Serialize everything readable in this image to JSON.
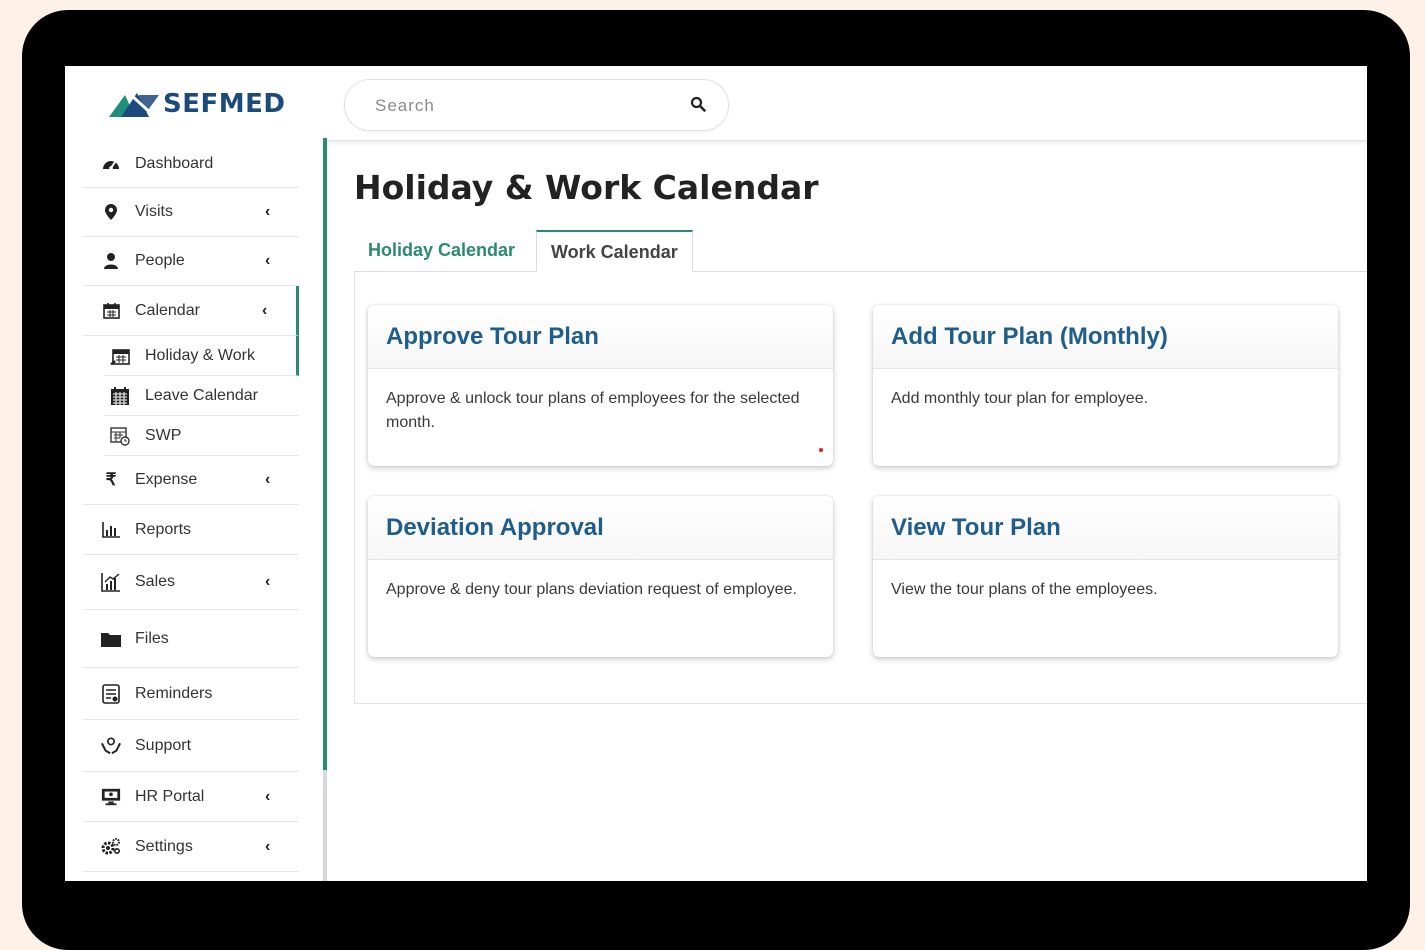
{
  "brand": {
    "logo_text": "SEFMED"
  },
  "search": {
    "placeholder": "Search"
  },
  "sidebar": {
    "items": [
      {
        "label": "Dashboard",
        "icon": "dashboard-icon",
        "has_chevron": false
      },
      {
        "label": "Visits",
        "icon": "map-pin-icon",
        "has_chevron": true
      },
      {
        "label": "People",
        "icon": "user-icon",
        "has_chevron": true
      },
      {
        "label": "Calendar",
        "icon": "calendar-icon",
        "has_chevron": true,
        "active": true
      },
      {
        "label": "Expense",
        "icon": "rupee-icon",
        "has_chevron": true
      },
      {
        "label": "Reports",
        "icon": "bar-chart-icon",
        "has_chevron": false
      },
      {
        "label": "Sales",
        "icon": "sales-chart-icon",
        "has_chevron": true
      },
      {
        "label": "Files",
        "icon": "folder-icon",
        "has_chevron": false
      },
      {
        "label": "Reminders",
        "icon": "reminder-list-icon",
        "has_chevron": false
      },
      {
        "label": "Support",
        "icon": "support-hands-icon",
        "has_chevron": false
      },
      {
        "label": "HR Portal",
        "icon": "monitor-icon",
        "has_chevron": true
      },
      {
        "label": "Settings",
        "icon": "gears-icon",
        "has_chevron": true
      }
    ],
    "calendar_sub": [
      {
        "label": "Holiday & Work",
        "icon": "calendar-edit-icon",
        "active": true
      },
      {
        "label": "Leave Calendar",
        "icon": "calendar-grid-icon"
      },
      {
        "label": "SWP",
        "icon": "calendar-clock-icon"
      }
    ],
    "chevron": "‹"
  },
  "page": {
    "title": "Holiday & Work Calendar",
    "tabs": [
      {
        "label": "Holiday Calendar"
      },
      {
        "label": "Work Calendar",
        "active": true
      }
    ]
  },
  "cards": [
    {
      "title": "Approve Tour Plan",
      "description": "Approve & unlock tour plans of employees for the selected month."
    },
    {
      "title": "Add Tour Plan (Monthly)",
      "description": "Add monthly tour plan for employee."
    },
    {
      "title": "Deviation Approval",
      "description": "Approve & deny tour plans deviation request of employee."
    },
    {
      "title": "View Tour Plan",
      "description": "View the tour plans of the employees."
    }
  ],
  "colors": {
    "accent": "#2a8a72",
    "card_title": "#1f5e8c",
    "brand_blue": "#1b4a7c",
    "brand_teal": "#1f8f7a",
    "frame": "#000000",
    "backdrop": "#fdf1e8"
  }
}
